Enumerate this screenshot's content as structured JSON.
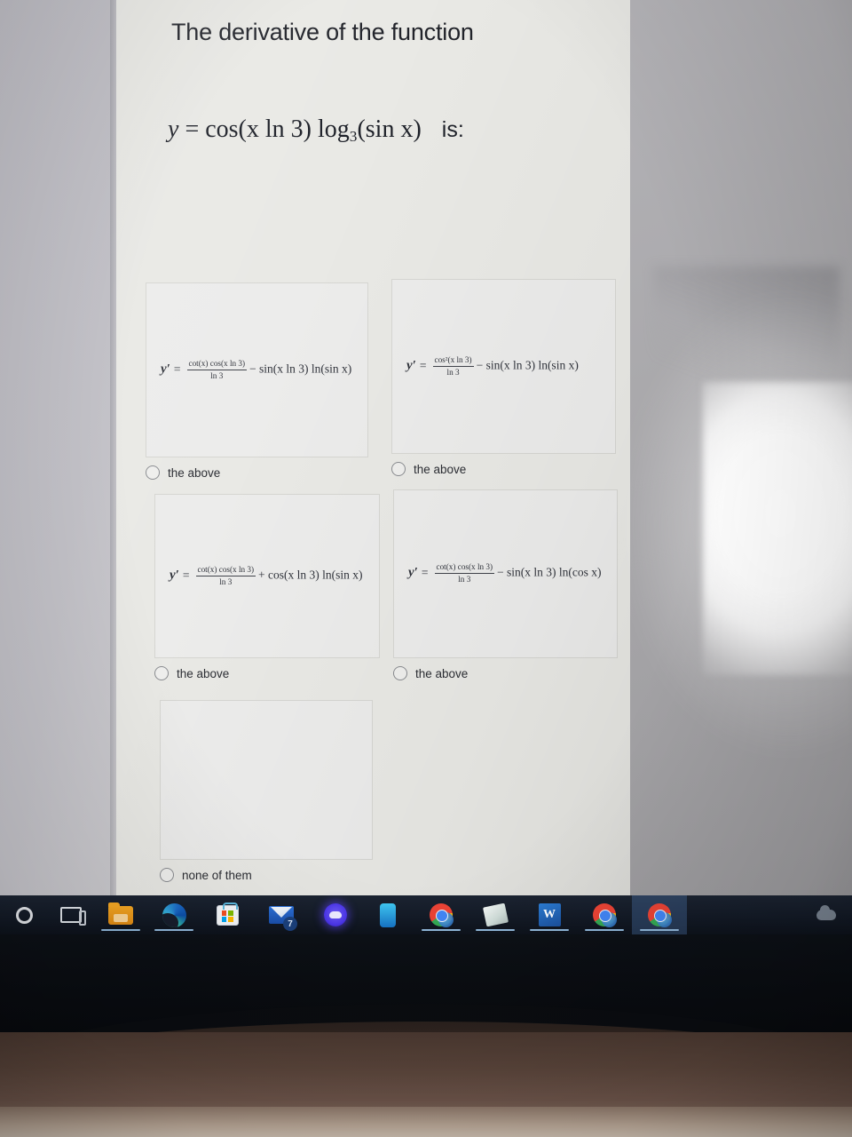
{
  "question": {
    "title": "The derivative of the function",
    "equation": {
      "lhs": "y",
      "eq": "=",
      "body_pre": "cos(x ln 3) log",
      "body_sub": "3",
      "body_post": "(sin x)",
      "suffix": "is:"
    }
  },
  "options": [
    {
      "id": "option-1",
      "label": "the above",
      "selected": false,
      "formula": {
        "lhs": "y′",
        "eq": "=",
        "numerator": "cot(x) cos(x ln 3)",
        "denominator": "ln 3",
        "tail": "− sin(x ln 3) ln(sin x)"
      }
    },
    {
      "id": "option-2",
      "label": "the above",
      "selected": false,
      "formula": {
        "lhs": "y′",
        "eq": "=",
        "numerator": "cos²(x ln 3)",
        "denominator": "ln 3",
        "tail": "− sin(x ln 3) ln(sin x)"
      }
    },
    {
      "id": "option-3",
      "label": "the above",
      "selected": false,
      "formula": {
        "lhs": "y′",
        "eq": "=",
        "numerator": "cot(x) cos(x ln 3)",
        "denominator": "ln 3",
        "tail": "+ cos(x ln 3) ln(sin x)"
      }
    },
    {
      "id": "option-4",
      "label": "the above",
      "selected": false,
      "formula": {
        "lhs": "y′",
        "eq": "=",
        "numerator": "cot(x) cos(x ln 3)",
        "denominator": "ln 3",
        "tail": "− sin(x ln 3) ln(cos x)"
      }
    },
    {
      "id": "option-5",
      "label": "none of them",
      "selected": false,
      "formula": {
        "lhs": "",
        "eq": "",
        "numerator": "",
        "denominator": "",
        "tail": ""
      }
    }
  ],
  "taskbar": {
    "items": [
      {
        "name": "cortana-icon",
        "label": "Cortana",
        "running": false,
        "active": false
      },
      {
        "name": "task-view-icon",
        "label": "Task View",
        "running": false,
        "active": false
      },
      {
        "name": "file-explorer-icon",
        "label": "File Explorer",
        "running": true,
        "active": false
      },
      {
        "name": "edge-icon",
        "label": "Microsoft Edge",
        "running": true,
        "active": false
      },
      {
        "name": "microsoft-store-icon",
        "label": "Microsoft Store",
        "running": false,
        "active": false
      },
      {
        "name": "mail-icon",
        "label": "Mail",
        "badge": "7",
        "running": false,
        "active": false
      },
      {
        "name": "discord-icon",
        "label": "Discord",
        "running": false,
        "active": false
      },
      {
        "name": "blue-app-icon",
        "label": "App",
        "running": false,
        "active": false
      },
      {
        "name": "chrome-icon",
        "label": "Google Chrome",
        "running": true,
        "active": false
      },
      {
        "name": "paper-app-icon",
        "label": "Notes",
        "running": true,
        "active": false
      },
      {
        "name": "word-icon",
        "label": "W",
        "running": true,
        "active": false
      },
      {
        "name": "chrome-icon",
        "label": "Google Chrome",
        "running": true,
        "active": false
      },
      {
        "name": "chrome-icon",
        "label": "Google Chrome",
        "running": true,
        "active": true
      }
    ],
    "tray": [
      {
        "name": "onedrive-cloud-icon",
        "label": "OneDrive"
      }
    ]
  },
  "colors": {
    "page_background": "#e9e9e5",
    "card_background": "#ececeb",
    "card_border": "#d6d6d2",
    "text": "#21232a",
    "taskbar": "#131a26",
    "taskbar_underline": "#8fb6d8",
    "desk": "#6b5349"
  }
}
